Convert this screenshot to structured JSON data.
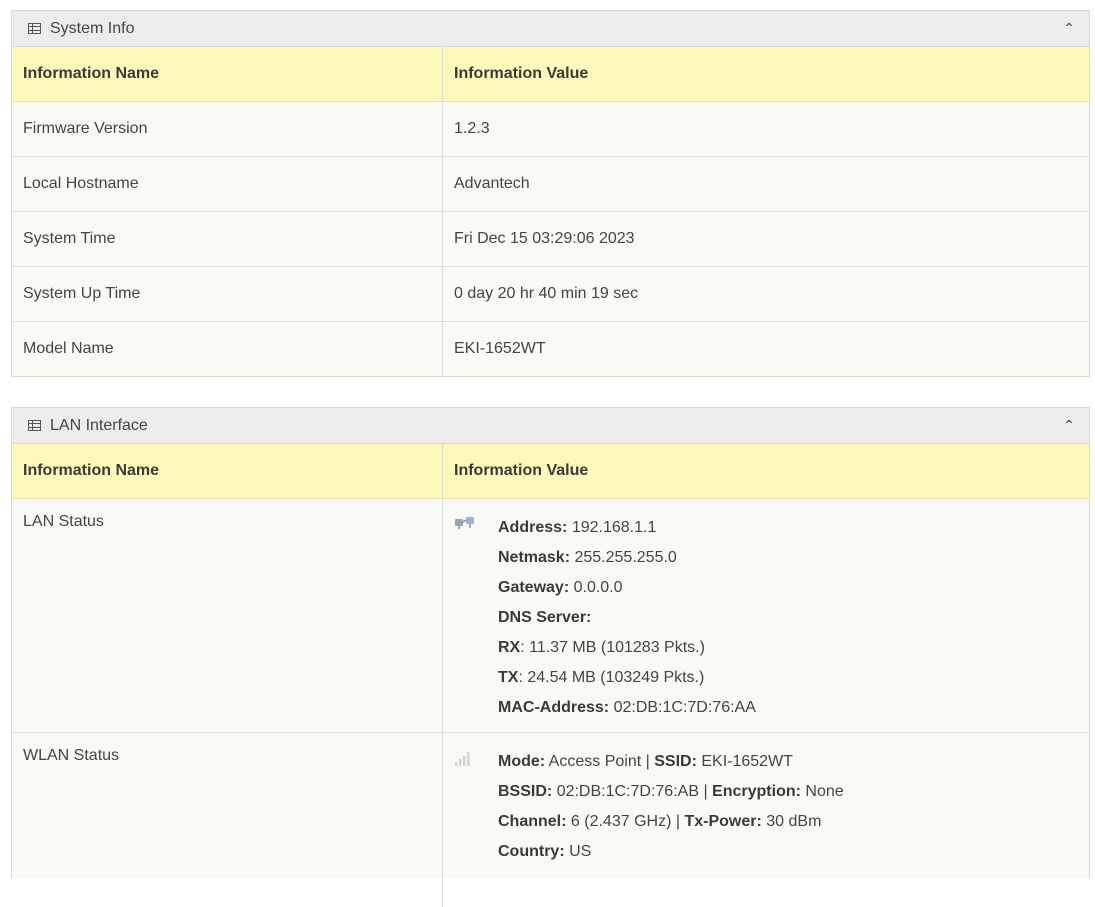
{
  "system_info": {
    "title": "System Info",
    "columns": [
      "Information Name",
      "Information Value"
    ],
    "rows": [
      {
        "name": "Firmware Version",
        "value": "1.2.3"
      },
      {
        "name": "Local Hostname",
        "value": "Advantech"
      },
      {
        "name": "System Time",
        "value": "Fri Dec 15 03:29:06 2023"
      },
      {
        "name": "System Up Time",
        "value": "0 day 20 hr 40 min 19 sec"
      },
      {
        "name": "Model Name",
        "value": "EKI-1652WT"
      }
    ]
  },
  "lan_interface": {
    "title": "LAN Interface",
    "columns": [
      "Information Name",
      "Information Value"
    ],
    "lan_status": {
      "name": "LAN Status",
      "icon": "ethernet-icon",
      "address_label": "Address:",
      "address": "192.168.1.1",
      "netmask_label": "Netmask:",
      "netmask": "255.255.255.0",
      "gateway_label": "Gateway:",
      "gateway": "0.0.0.0",
      "dns_label": "DNS Server:",
      "rx_label": "RX",
      "rx": ": 11.37 MB (101283 Pkts.)",
      "tx_label": "TX",
      "tx": ": 24.54 MB (103249 Pkts.)",
      "mac_label": "MAC-Address:",
      "mac": "02:DB:1C:7D:76:AA"
    },
    "wlan_status": {
      "name": "WLAN Status",
      "icon": "signal-icon",
      "mode_label": "Mode:",
      "mode": "Access Point",
      "ssid_label": "SSID:",
      "ssid": "EKI-1652WT",
      "bssid_label": "BSSID:",
      "bssid": "02:DB:1C:7D:76:AB",
      "encryption_label": "Encryption:",
      "encryption": "None",
      "channel_label": "Channel:",
      "channel": "6 (2.437 GHz)",
      "txpower_label": "Tx-Power:",
      "txpower": "30 dBm",
      "country_label": "Country:",
      "country": "US",
      "separator": "|"
    }
  },
  "colors": {
    "header_bg": "#ececec",
    "column_header_bg": "#fdf9b8",
    "row_bg": "#fafaf5"
  }
}
